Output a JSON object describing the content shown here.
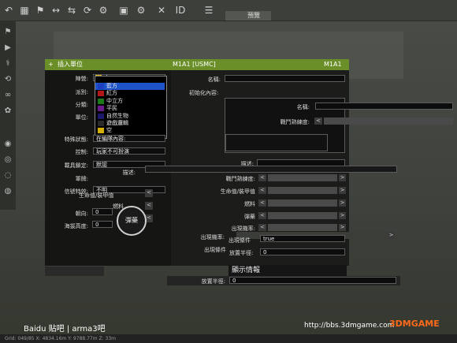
{
  "topbar": {
    "tab1": "",
    "tab2": "預覽"
  },
  "dialog": {
    "title_left": "插入單位",
    "title_center": "M1A1  [USMC]",
    "title_right": "M1A1",
    "left": {
      "side_label": "陣營:",
      "side_value": "空",
      "source_label": "派別:",
      "class_label": "分類:",
      "unit_label": "單位:",
      "special_label": "特殊狀態:",
      "special_value": "在編隊內容:",
      "control_label": "控制:",
      "control_value": "玩家不可扮演",
      "lock_label": "載具鎖定:",
      "lock_value": "默認",
      "desc_label": "描述:",
      "wing_label": "軍牌:",
      "skill_label": "信號特效:",
      "skill_value": "不明",
      "health_label": "生命值/裝甲值",
      "fuel_label": "燃料",
      "ammo_label": "彈藥",
      "azimuth_label": "朝向:",
      "azimuth_value": "0",
      "altitude_label": "海拔高度:",
      "altitude_value": "0"
    },
    "right": {
      "name_label": "名稱:",
      "init_label": "初始化內容:",
      "name2_label": "名稱:",
      "combat_label": "戰鬥熟練度:",
      "desc_label": "描述:",
      "combat2_label": "戰鬥熟練度:",
      "health_label": "生命值/裝甲值",
      "fuel_label": "燃料",
      "ammo_label": "彈藥",
      "prob_label": "出現機率:",
      "cond_label": "出現條件",
      "cond_value": "true",
      "radius_label": "放置半徑:",
      "radius_value": "0"
    },
    "dropdown_items": [
      {
        "label": "藍方",
        "color": "#1c3fbf"
      },
      {
        "label": "紅方",
        "color": "#b01818"
      },
      {
        "label": "中立方",
        "color": "#1a7a1a"
      },
      {
        "label": "平民",
        "color": "#6a1a8a"
      },
      {
        "label": "自然生物",
        "color": "#1a1a6a"
      },
      {
        "label": "遊戲邏輯",
        "color": "#2a2a2a"
      },
      {
        "label": "空",
        "color": "#d6b000"
      }
    ],
    "overlay": {
      "prob_label": "出現機率:",
      "cond_label": "出現條件",
      "cond_value": "true",
      "radius_label": "放置半徑:",
      "radius_value": "0",
      "show_info": "顯示情報",
      "bottom_radius_label": "放置半徑:",
      "bottom_radius_value": "0"
    },
    "compass_label": "彈藥"
  },
  "footer": {
    "watermark_left": "Baidu 贴吧 | arma3吧",
    "watermark_right": "http://bbs.3dmgame.com",
    "brand": "3DMGAME",
    "coords": "Grid: 049/85   X: 4834.16m   Y: 9788.77m   Z: 33m"
  },
  "colors": {
    "accent": "#6a8f28"
  }
}
